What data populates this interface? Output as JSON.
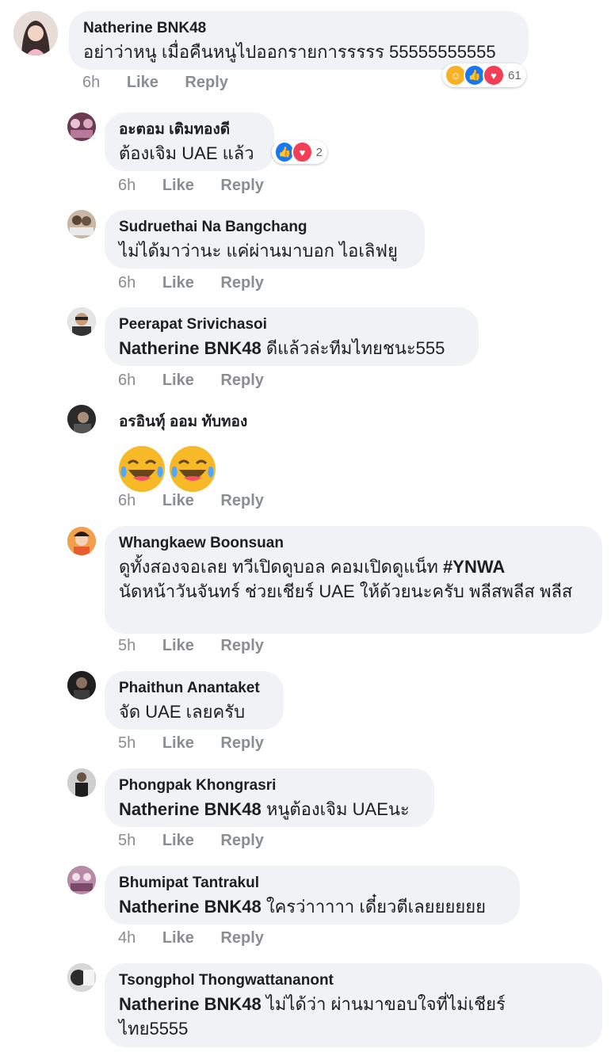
{
  "comments": [
    {
      "name": "Natherine BNK48",
      "text": "อย่าว่าหนู เมื่อคืนหนูไปออกรายการรรรร 55555555555",
      "time": "6h",
      "like": "Like",
      "reply": "Reply",
      "reactions": {
        "count": "61",
        "types": [
          "haha-icon",
          "like-icon",
          "love-icon"
        ]
      }
    },
    {
      "name": "อะตอม เติมทองดี",
      "text": "ต้องเจิม UAE แล้ว",
      "time": "6h",
      "like": "Like",
      "reply": "Reply",
      "reactions": {
        "count": "2",
        "types": [
          "like-icon",
          "love-icon"
        ]
      }
    },
    {
      "name": "Sudruethai Na Bangchang",
      "text": "ไม่ได้มาว่านะ แค่ผ่านมาบอก ไอเลิฟยู",
      "time": "6h",
      "like": "Like",
      "reply": "Reply"
    },
    {
      "name": "Peerapat Srivichasoi",
      "mention": "Natherine BNK48",
      "text": " ดีแล้วล่ะทีมไทยชนะ555",
      "time": "6h",
      "like": "Like",
      "reply": "Reply"
    },
    {
      "name": "อรอินทุ์ ออม ทับทอง",
      "emoji": [
        "tears-of-joy-icon",
        "tears-of-joy-icon"
      ],
      "time": "6h",
      "like": "Like",
      "reply": "Reply"
    },
    {
      "name": "Whangkaew Boonsuan",
      "text_line1": "ดูทั้งสองจอเลย ทวีเปิดดูบอล คอมเปิดดูแน็ท ",
      "hashtag": "#YNWA",
      "text_rest": "นัดหน้าวันจันทร์ ช่วยเชียร์ UAE ให้ด้วยนะครับ พลีสพลีส พลีส",
      "time": "5h",
      "like": "Like",
      "reply": "Reply"
    },
    {
      "name": "Phaithun Anantaket",
      "text": "จัด UAE เลยครับ",
      "time": "5h",
      "like": "Like",
      "reply": "Reply"
    },
    {
      "name": "Phongpak Khongrasri",
      "mention": "Natherine BNK48",
      "text": " หนูต้องเจิม UAEนะ",
      "time": "5h",
      "like": "Like",
      "reply": "Reply"
    },
    {
      "name": "Bhumipat Tantrakul",
      "mention": "Natherine BNK48",
      "text": " ใครว่าาาาา เดี๋ยวตีเลยยยยยย",
      "time": "4h",
      "like": "Like",
      "reply": "Reply"
    },
    {
      "name": "Tsongphol Thongwattananont",
      "mention": "Natherine BNK48",
      "text": " ไม่ได้ว่า  ผ่านมาขอบใจที่ไม่เชียร์ไทย5555",
      "time": "",
      "like": "",
      "reply": ""
    }
  ],
  "colors": {
    "bubble": "#f0f2f5",
    "secondary_text": "#8a8d91",
    "like_blue": "#1877f2",
    "love_red": "#f33e58",
    "haha_yellow": "#f7b125"
  }
}
